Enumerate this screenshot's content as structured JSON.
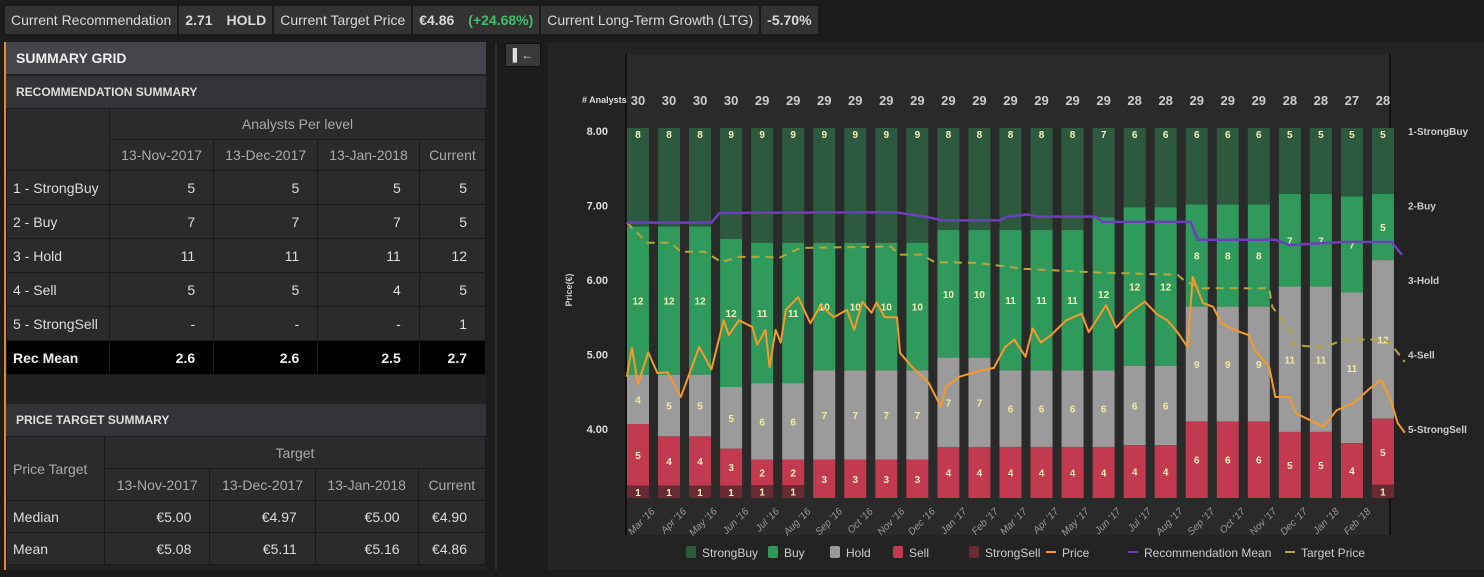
{
  "topbar": {
    "rec_label": "Current Recommendation",
    "rec_value": "2.71",
    "rec_text": "HOLD",
    "tp_label": "Current Target Price",
    "tp_value": "€4.86",
    "tp_change": "(+24.68%)",
    "ltg_label": "Current Long-Term Growth (LTG)",
    "ltg_value": "-5.70%"
  },
  "left": {
    "title": "SUMMARY GRID",
    "collapse_icon": "collapse-left-icon",
    "rec": {
      "title": "RECOMMENDATION SUMMARY",
      "group_header": "Analysts Per level",
      "columns": [
        "13-Nov-2017",
        "13-Dec-2017",
        "13-Jan-2018",
        "Current"
      ],
      "rows": [
        [
          "1 - StrongBuy",
          "5",
          "5",
          "5",
          "5"
        ],
        [
          "2 - Buy",
          "7",
          "7",
          "7",
          "5"
        ],
        [
          "3 - Hold",
          "11",
          "11",
          "11",
          "12"
        ],
        [
          "4 - Sell",
          "5",
          "5",
          "4",
          "5"
        ],
        [
          "5 - StrongSell",
          "-",
          "-",
          "-",
          "1"
        ]
      ],
      "mean_row": [
        "Rec Mean",
        "2.6",
        "2.6",
        "2.5",
        "2.7"
      ]
    },
    "pt": {
      "title": "PRICE TARGET SUMMARY",
      "row_header": "Price Target",
      "group_header": "Target",
      "columns": [
        "13-Nov-2017",
        "13-Dec-2017",
        "13-Jan-2018",
        "Current"
      ],
      "rows": [
        [
          "Median",
          "€5.00",
          "€4.97",
          "€5.00",
          "€4.90"
        ],
        [
          "Mean",
          "€5.08",
          "€5.11",
          "€5.16",
          "€4.86"
        ]
      ]
    }
  },
  "colors": {
    "strongbuy": "#2d5a3e",
    "buy": "#2f9a5b",
    "hold": "#9b9b9b",
    "sell": "#c23a50",
    "strongsell": "#6a2a33",
    "price": "#f39a2c",
    "recmean": "#6b3fbe",
    "target": "#b5a63a",
    "positive": "#3fbf6a"
  },
  "chart_data": {
    "type": "bar+line",
    "ylabel": "Price(€)",
    "analysts_label": "# Analysts",
    "ylim": [
      3.0,
      8.0
    ],
    "yticks": [
      "8.00",
      "7.00",
      "6.00",
      "5.00",
      "4.00"
    ],
    "right_axis": {
      "labels": [
        "1-StrongBuy",
        "2-Buy",
        "3-Hold",
        "4-Sell",
        "5-StrongSell"
      ],
      "range": [
        1,
        5
      ]
    },
    "xtick_labels": [
      "Mar '16",
      "Apr '16",
      "May '16",
      "Jun '16",
      "Jul '16",
      "Aug '16",
      "Sep '16",
      "Oct '16",
      "Nov '16",
      "Dec '16",
      "Jan '17",
      "Feb '17",
      "Mar '17",
      "Apr '17",
      "May '17",
      "Jun '17",
      "Jul '17",
      "Aug '17",
      "Sep '17",
      "Oct '17",
      "Nov '17",
      "Dec '17",
      "Jan '18",
      "Feb '18"
    ],
    "analysts": [
      30,
      30,
      30,
      30,
      29,
      29,
      29,
      29,
      29,
      29,
      29,
      29,
      29,
      29,
      29,
      29,
      28,
      28,
      29,
      29,
      29,
      28,
      28,
      27,
      28
    ],
    "series": [
      {
        "name": "StrongBuy",
        "values": [
          8,
          8,
          8,
          9,
          9,
          9,
          9,
          9,
          9,
          9,
          8,
          8,
          8,
          8,
          8,
          7,
          6,
          6,
          6,
          6,
          6,
          5,
          5,
          5,
          5
        ]
      },
      {
        "name": "Buy",
        "values": [
          12,
          12,
          12,
          12,
          11,
          11,
          10,
          10,
          10,
          10,
          10,
          10,
          11,
          11,
          11,
          12,
          12,
          12,
          8,
          8,
          8,
          7,
          7,
          7,
          5
        ]
      },
      {
        "name": "Hold",
        "values": [
          4,
          5,
          5,
          5,
          6,
          6,
          7,
          7,
          7,
          7,
          7,
          7,
          6,
          6,
          6,
          6,
          6,
          6,
          9,
          9,
          9,
          11,
          11,
          11,
          12
        ]
      },
      {
        "name": "Sell",
        "values": [
          5,
          4,
          4,
          3,
          2,
          2,
          3,
          3,
          3,
          3,
          4,
          4,
          4,
          4,
          4,
          4,
          4,
          4,
          6,
          6,
          6,
          5,
          5,
          4,
          5
        ]
      },
      {
        "name": "StrongSell",
        "values": [
          1,
          1,
          1,
          1,
          1,
          1,
          0,
          0,
          0,
          0,
          0,
          0,
          0,
          0,
          0,
          0,
          0,
          0,
          0,
          0,
          0,
          0,
          0,
          0,
          1
        ]
      }
    ],
    "price": [
      [
        "2016-02-02",
        4.7
      ],
      [
        "2016-02-07",
        5.09
      ],
      [
        "2016-02-13",
        4.6
      ],
      [
        "2016-02-23",
        5.03
      ],
      [
        "2016-03-03",
        4.75
      ],
      [
        "2016-03-13",
        4.76
      ],
      [
        "2016-03-26",
        4.43
      ],
      [
        "2016-04-13",
        5.1
      ],
      [
        "2016-04-25",
        4.8
      ],
      [
        "2016-05-07",
        5.46
      ],
      [
        "2016-05-12",
        5.26
      ],
      [
        "2016-05-22",
        5.46
      ],
      [
        "2016-06-04",
        5.37
      ],
      [
        "2016-06-09",
        5.13
      ],
      [
        "2016-06-17",
        5.33
      ],
      [
        "2016-06-21",
        4.83
      ],
      [
        "2016-06-27",
        5.33
      ],
      [
        "2016-07-02",
        5.16
      ],
      [
        "2016-07-07",
        5.6
      ],
      [
        "2016-07-19",
        5.77
      ],
      [
        "2016-07-31",
        5.42
      ],
      [
        "2016-08-10",
        5.66
      ],
      [
        "2016-08-23",
        5.5
      ],
      [
        "2016-09-05",
        5.6
      ],
      [
        "2016-09-12",
        5.33
      ],
      [
        "2016-09-20",
        5.71
      ],
      [
        "2016-09-29",
        5.56
      ],
      [
        "2016-10-04",
        5.7
      ],
      [
        "2016-10-12",
        5.5
      ],
      [
        "2016-10-24",
        5.5
      ],
      [
        "2016-10-27",
        5.02
      ],
      [
        "2016-11-08",
        4.83
      ],
      [
        "2016-11-24",
        4.62
      ],
      [
        "2016-12-06",
        4.3
      ],
      [
        "2016-12-11",
        4.57
      ],
      [
        "2016-12-24",
        4.7
      ],
      [
        "2017-01-10",
        4.77
      ],
      [
        "2017-01-27",
        4.82
      ],
      [
        "2017-02-07",
        5.1
      ],
      [
        "2017-02-16",
        5.2
      ],
      [
        "2017-02-27",
        4.97
      ],
      [
        "2017-03-06",
        5.35
      ],
      [
        "2017-03-14",
        5.16
      ],
      [
        "2017-03-24",
        5.26
      ],
      [
        "2017-04-08",
        5.46
      ],
      [
        "2017-04-23",
        5.55
      ],
      [
        "2017-04-30",
        5.3
      ],
      [
        "2017-05-17",
        5.66
      ],
      [
        "2017-05-27",
        5.36
      ],
      [
        "2017-06-09",
        5.56
      ],
      [
        "2017-06-24",
        5.71
      ],
      [
        "2017-07-06",
        5.54
      ],
      [
        "2017-07-16",
        5.46
      ],
      [
        "2017-07-26",
        5.3
      ],
      [
        "2017-08-05",
        5.1
      ],
      [
        "2017-08-10",
        6.04
      ],
      [
        "2017-08-20",
        5.69
      ],
      [
        "2017-08-30",
        5.64
      ],
      [
        "2017-09-07",
        5.42
      ],
      [
        "2017-09-20",
        5.33
      ],
      [
        "2017-10-04",
        5.26
      ],
      [
        "2017-10-10",
        5.06
      ],
      [
        "2017-10-24",
        4.83
      ],
      [
        "2017-10-30",
        4.43
      ],
      [
        "2017-11-13",
        4.43
      ],
      [
        "2017-11-19",
        4.21
      ],
      [
        "2017-12-03",
        4.12
      ],
      [
        "2017-12-16",
        4.03
      ],
      [
        "2017-12-29",
        4.25
      ],
      [
        "2018-01-15",
        4.35
      ],
      [
        "2018-02-01",
        4.56
      ],
      [
        "2018-02-11",
        4.66
      ],
      [
        "2018-02-21",
        4.35
      ],
      [
        "2018-02-27",
        4.08
      ],
      [
        "2018-03-06",
        3.95
      ]
    ],
    "recommendation_mean": [
      [
        "2016-02-02",
        2.23
      ],
      [
        "2016-04-25",
        2.23
      ],
      [
        "2016-05-03",
        2.1
      ],
      [
        "2016-10-22",
        2.09
      ],
      [
        "2016-11-21",
        2.15
      ],
      [
        "2016-12-08",
        2.2
      ],
      [
        "2017-02-02",
        2.2
      ],
      [
        "2017-02-09",
        2.15
      ],
      [
        "2017-03-01",
        2.12
      ],
      [
        "2017-03-11",
        2.15
      ],
      [
        "2017-05-07",
        2.15
      ],
      [
        "2017-05-13",
        2.22
      ],
      [
        "2017-08-08",
        2.22
      ],
      [
        "2017-08-15",
        2.46
      ],
      [
        "2017-10-30",
        2.46
      ],
      [
        "2017-11-13",
        2.53
      ],
      [
        "2018-01-05",
        2.49
      ],
      [
        "2018-02-21",
        2.49
      ],
      [
        "2018-03-03",
        2.66
      ]
    ],
    "target_price": [
      [
        "2016-02-02",
        6.77
      ],
      [
        "2016-02-22",
        6.5
      ],
      [
        "2016-03-16",
        6.5
      ],
      [
        "2016-03-26",
        6.38
      ],
      [
        "2016-04-18",
        6.38
      ],
      [
        "2016-05-05",
        6.24
      ],
      [
        "2016-05-22",
        6.31
      ],
      [
        "2016-06-14",
        6.31
      ],
      [
        "2016-07-01",
        6.3
      ],
      [
        "2016-07-21",
        6.43
      ],
      [
        "2016-10-18",
        6.45
      ],
      [
        "2016-10-26",
        6.34
      ],
      [
        "2016-11-17",
        6.34
      ],
      [
        "2016-11-30",
        6.24
      ],
      [
        "2017-01-10",
        6.23
      ],
      [
        "2017-02-26",
        6.15
      ],
      [
        "2017-05-10",
        6.1
      ],
      [
        "2017-07-26",
        6.07
      ],
      [
        "2017-08-01",
        6.0
      ],
      [
        "2017-08-18",
        5.89
      ],
      [
        "2017-10-24",
        5.89
      ],
      [
        "2017-10-27",
        5.64
      ],
      [
        "2017-11-13",
        5.33
      ],
      [
        "2017-11-16",
        5.13
      ],
      [
        "2017-12-16",
        5.09
      ],
      [
        "2018-01-05",
        5.2
      ],
      [
        "2018-02-14",
        5.2
      ],
      [
        "2018-02-21",
        5.13
      ],
      [
        "2018-03-06",
        4.9
      ]
    ],
    "legend": [
      "StrongBuy",
      "Buy",
      "Hold",
      "Sell",
      "StrongSell",
      "Price",
      "Recommendation Mean",
      "Target Price"
    ],
    "legend_position": "bottom",
    "grid": false
  }
}
